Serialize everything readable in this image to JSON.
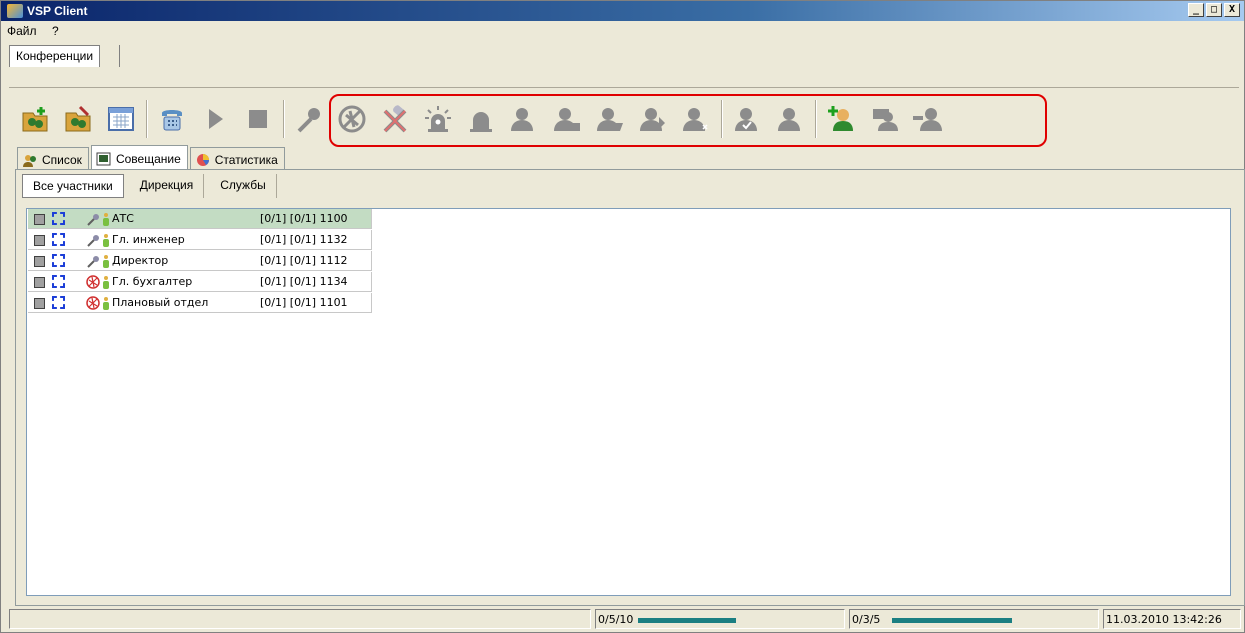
{
  "window": {
    "title": "VSP Client",
    "controls": [
      "_",
      "□",
      "X"
    ]
  },
  "menu": {
    "items": [
      "Файл",
      "?"
    ]
  },
  "top_tab": {
    "label": "Конференции"
  },
  "toolbar": {
    "left_buttons": [
      "add-conference-icon",
      "edit-conference-icon",
      "calendar-icon",
      "phone-icon",
      "play-icon",
      "stop-icon"
    ],
    "highlighted_buttons": [
      "mute-icon",
      "disable-microphone-icon",
      "no-sound-icon",
      "alarm-icon",
      "bell-icon",
      "user-icon",
      "user-icon",
      "user-icon",
      "user-icon",
      "user-check-icon",
      "user-icon",
      "add-user-icon",
      "user-group-icon",
      "remove-user-icon"
    ],
    "highlight_color": "#e00000"
  },
  "view_tabs": [
    {
      "label": "Список",
      "icon": "users-icon"
    },
    {
      "label": "Совещание",
      "icon": "meeting-icon"
    },
    {
      "label": "Статистика",
      "icon": "pie-chart-icon"
    }
  ],
  "sub_tabs": [
    "Все участники",
    "Дирекция",
    "Службы"
  ],
  "participants": [
    {
      "name": "АТС",
      "info": "[0/1] [0/1] 1100",
      "status": "mic",
      "selected": true
    },
    {
      "name": "Гл. инженер",
      "info": "[0/1] [0/1] 1132",
      "status": "mic",
      "selected": false
    },
    {
      "name": "Директор",
      "info": "[0/1] [0/1] 1112",
      "status": "mic",
      "selected": false
    },
    {
      "name": "Гл. бухгалтер",
      "info": "[0/1] [0/1] 1134",
      "status": "blocked",
      "selected": false
    },
    {
      "name": "Плановый отдел",
      "info": "[0/1] [0/1] 1101",
      "status": "blocked",
      "selected": false
    }
  ],
  "status": {
    "counter1": "0/5/10",
    "counter2": "0/3/5",
    "datetime": "11.03.2010 13:42:26"
  },
  "colors": {
    "selected_row": "#c3dcc3",
    "progress": "#1b7f82",
    "frame": "#1c3ed8"
  }
}
